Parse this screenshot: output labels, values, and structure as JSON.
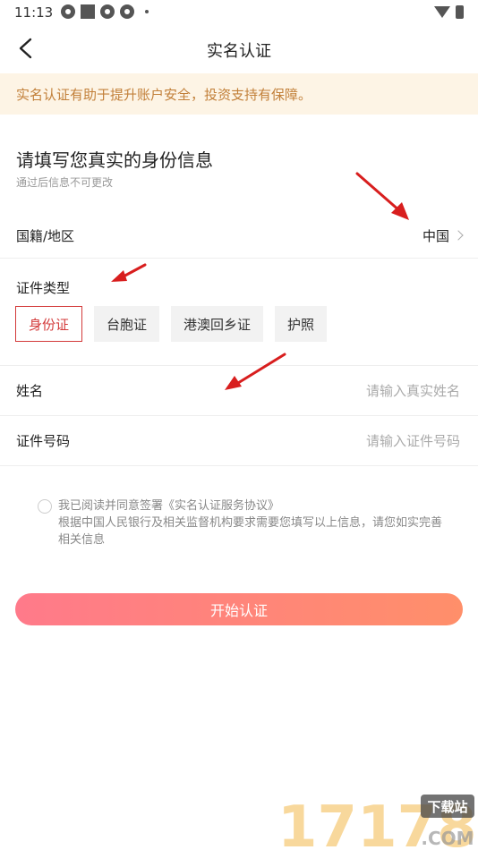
{
  "status_bar": {
    "time": "11:13"
  },
  "nav": {
    "title": "实名认证"
  },
  "banner": {
    "text": "实名认证有助于提升账户安全，投资支持有保障。"
  },
  "heading": {
    "title": "请填写您真实的身份信息",
    "subtitle": "通过后信息不可更改"
  },
  "country": {
    "label": "国籍/地区",
    "value": "中国"
  },
  "id_type": {
    "label": "证件类型",
    "options": [
      "身份证",
      "台胞证",
      "港澳回乡证",
      "护照"
    ],
    "selected": "身份证"
  },
  "name_field": {
    "label": "姓名",
    "placeholder": "请输入真实姓名"
  },
  "id_number_field": {
    "label": "证件号码",
    "placeholder": "请输入证件号码"
  },
  "agreement": {
    "text_prefix": "我已阅读并同意签署",
    "link": "《实名认证服务协议》",
    "note": "根据中国人民银行及相关监督机构要求需要您填写以上信息，请您如实完善相关信息"
  },
  "submit": {
    "label": "开始认证"
  },
  "watermark": {
    "number": "17178",
    "site": "下载站",
    "domain": ".COM"
  },
  "colors": {
    "accent": "#d33a3a",
    "banner_bg": "#fdf4e5",
    "banner_text": "#c2803a",
    "button_start": "#ff7a8a",
    "button_end": "#ff8f6a"
  }
}
